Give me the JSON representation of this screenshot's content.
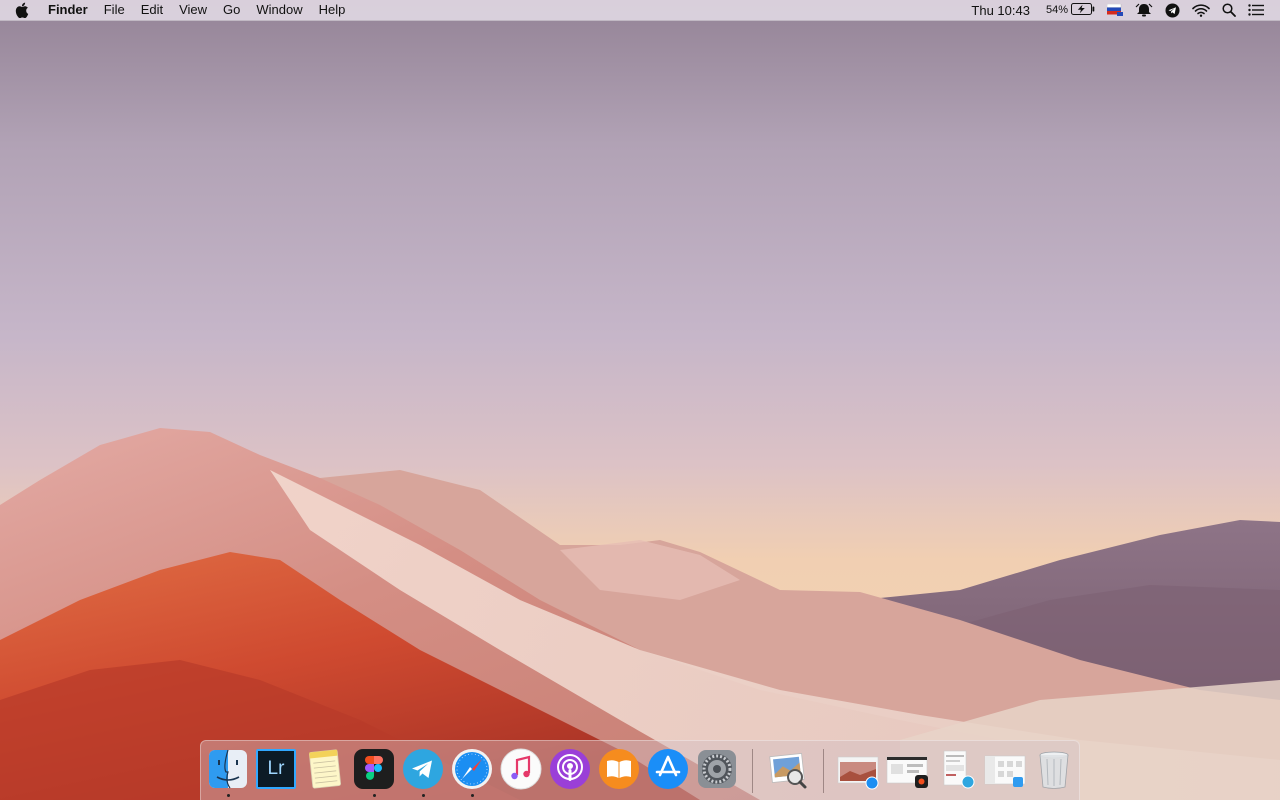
{
  "menubar": {
    "apple_icon": "apple-logo-icon",
    "app_name": "Finder",
    "menus": [
      "File",
      "Edit",
      "View",
      "Go",
      "Window",
      "Help"
    ],
    "clock": "Thu 10:43",
    "battery_percent": "54%",
    "status_icons": [
      "battery-charging-icon",
      "russian-flag-input-icon",
      "notification-icon",
      "telegram-status-icon",
      "wifi-icon",
      "spotlight-search-icon",
      "notification-center-icon"
    ]
  },
  "dock": {
    "apps": [
      {
        "name": "Finder",
        "icon": "finder-icon",
        "running": true
      },
      {
        "name": "Lightroom",
        "icon": "lightroom-icon",
        "label": "Lr",
        "running": false
      },
      {
        "name": "Notes",
        "icon": "notes-icon",
        "running": false
      },
      {
        "name": "Figma",
        "icon": "figma-icon",
        "running": true
      },
      {
        "name": "Telegram",
        "icon": "telegram-icon",
        "running": true
      },
      {
        "name": "Safari",
        "icon": "safari-icon",
        "running": true
      },
      {
        "name": "iTunes",
        "icon": "itunes-icon",
        "running": false
      },
      {
        "name": "Podcasts",
        "icon": "podcasts-icon",
        "running": false
      },
      {
        "name": "Books",
        "icon": "books-icon",
        "running": false
      },
      {
        "name": "App Store",
        "icon": "app-store-icon",
        "running": false
      },
      {
        "name": "System Preferences",
        "icon": "system-preferences-icon",
        "running": false
      },
      {
        "name": "Preview",
        "icon": "preview-icon",
        "running": false
      }
    ],
    "minimized": [
      {
        "icon": "minimized-safari-window-icon"
      },
      {
        "icon": "minimized-figma-window-icon"
      },
      {
        "icon": "minimized-telegram-window-icon"
      },
      {
        "icon": "minimized-finder-window-icon"
      }
    ],
    "trash": {
      "icon": "trash-icon"
    }
  },
  "colors": {
    "sky_top": "#9a8a99",
    "sky_mid": "#c4b2c6",
    "sky_horizon": "#f3cfae",
    "hill_orange": "#d85b3c",
    "hill_pink": "#d69a90"
  }
}
